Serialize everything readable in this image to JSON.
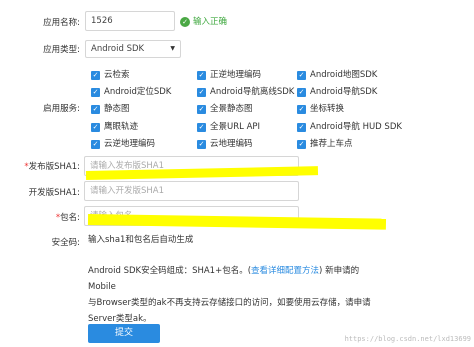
{
  "app_name": {
    "label": "应用名称:",
    "value": "1526",
    "valid_text": "输入正确"
  },
  "app_type": {
    "label": "应用类型:",
    "value": "Android SDK"
  },
  "services": {
    "label": "启用服务:",
    "items": [
      "云检索",
      "正逆地理编码",
      "Android地图SDK",
      "Android定位SDK",
      "Android导航离线SDK",
      "Android导航SDK",
      "静态图",
      "全景静态图",
      "坐标转换",
      "鹰眼轨迹",
      "全景URL API",
      "Android导航 HUD SDK",
      "云逆地理编码",
      "云地理编码",
      "推荐上车点"
    ]
  },
  "release_sha1": {
    "required": "*",
    "label": "发布版SHA1:",
    "placeholder": "请输入发布版SHA1"
  },
  "dev_sha1": {
    "label": "开发版SHA1:",
    "placeholder": "请输入开发版SHA1"
  },
  "package_name": {
    "required": "*",
    "label": "包名:",
    "placeholder": "请输入包名"
  },
  "security_code": {
    "label": "安全码:",
    "value": "输入sha1和包名后自动生成"
  },
  "note": {
    "line1_pre": "Android SDK安全码组成：SHA1+包名。(",
    "line1_link": "查看详细配置方法",
    "line1_post": ") 新申请的Mobile",
    "line2": "与Browser类型的ak不再支持云存储接口的访问，如要使用云存储，请申请",
    "line3": "Server类型ak。"
  },
  "submit_label": "提交",
  "watermark": "https://blog.csdn.net/lxd13699"
}
